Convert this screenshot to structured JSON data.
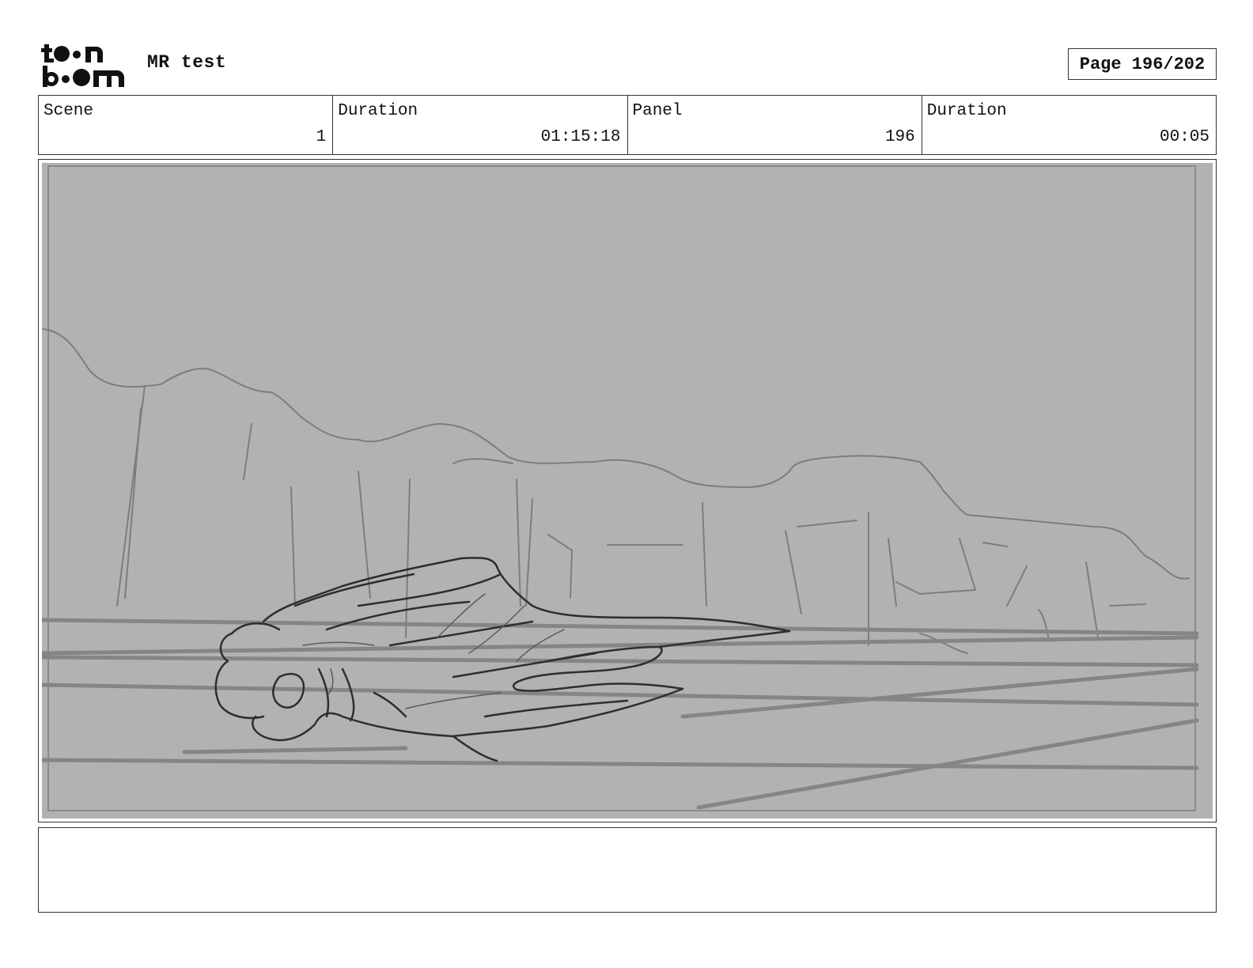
{
  "header": {
    "logo_name": "toonboom-logo",
    "project_title": "MR test",
    "page_label": "Page 196/202"
  },
  "info": {
    "scene_label": "Scene",
    "scene_value": "1",
    "scene_duration_label": "Duration",
    "scene_duration_value": "01:15:18",
    "panel_label": "Panel",
    "panel_value": "196",
    "panel_duration_label": "Duration",
    "panel_duration_value": "00:05"
  },
  "panel": {
    "background_color": "#b2b2b2",
    "sketch_color": "#2e2e2e",
    "guide_color": "#7d7d7d"
  },
  "notes": {
    "text": ""
  }
}
